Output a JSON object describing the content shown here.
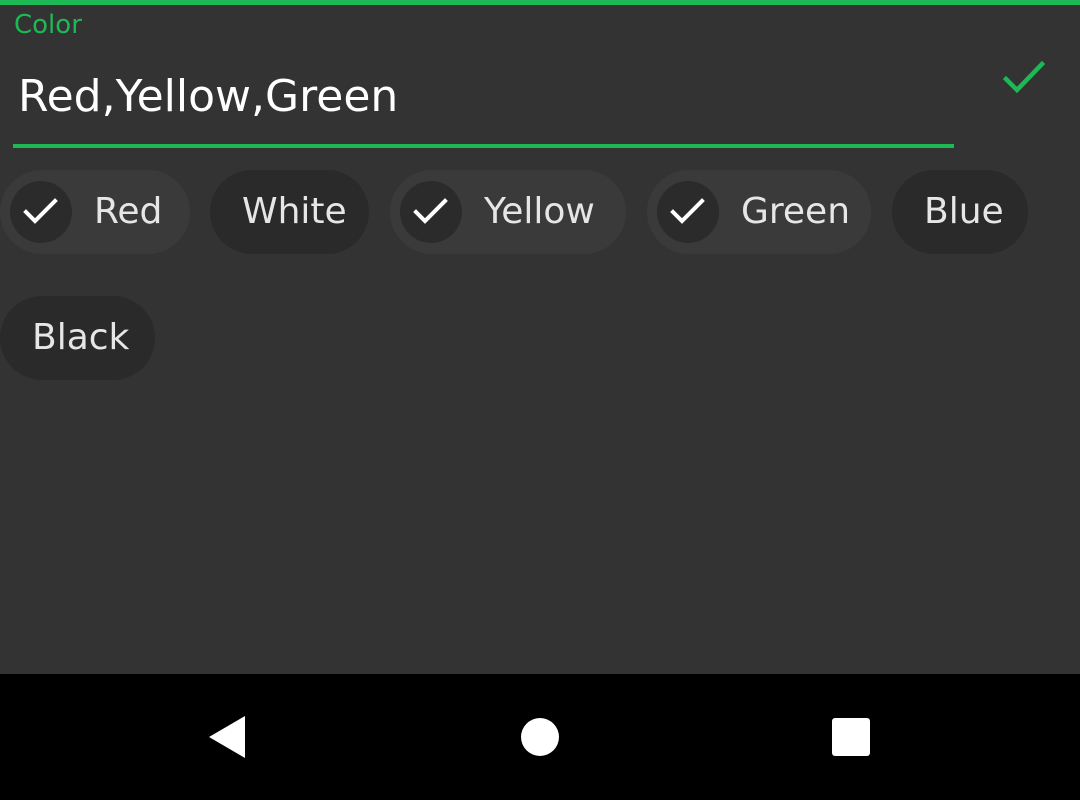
{
  "colors": {
    "accent": "#1db954",
    "background": "#333333",
    "chip_bg": "#2a2a2a",
    "chip_selected_bg": "#3a3a3a",
    "nav_bar": "#000000"
  },
  "field": {
    "label": "Color",
    "value": "Red,Yellow,Green",
    "confirm_icon": "check-icon"
  },
  "chips": [
    {
      "label": "Red",
      "selected": true
    },
    {
      "label": "White",
      "selected": false
    },
    {
      "label": "Yellow",
      "selected": true
    },
    {
      "label": "Green",
      "selected": true
    },
    {
      "label": "Blue",
      "selected": false
    },
    {
      "label": "Black",
      "selected": false
    }
  ],
  "nav": {
    "back_icon": "back-triangle-icon",
    "home_icon": "home-circle-icon",
    "recents_icon": "recents-square-icon"
  }
}
